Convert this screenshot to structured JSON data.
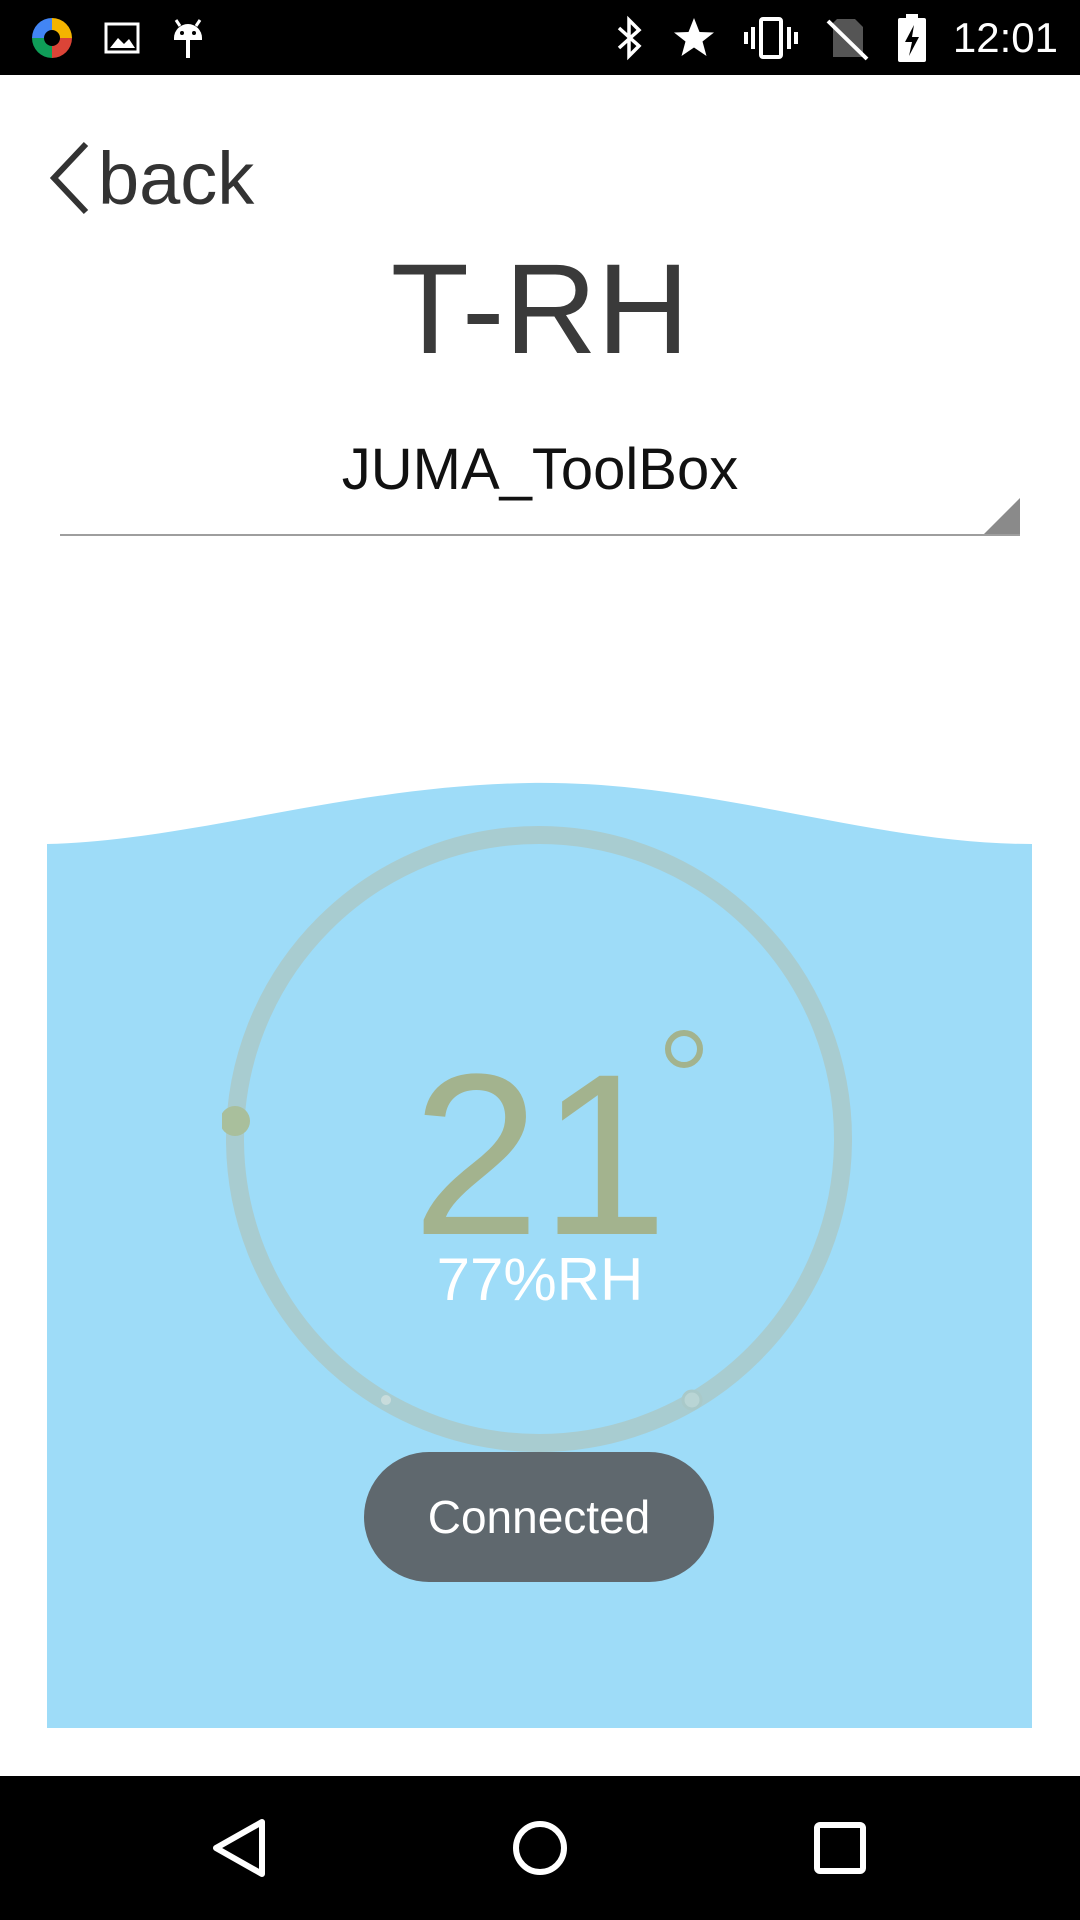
{
  "status_bar": {
    "time": "12:01",
    "left_icons": [
      "app-store-icon",
      "image-icon",
      "android-debug-icon"
    ],
    "right_icons": [
      "bluetooth-icon",
      "star-icon",
      "vibrate-icon",
      "no-sim-icon",
      "battery-charging-icon"
    ]
  },
  "header": {
    "back_label": "back",
    "title": "T-RH"
  },
  "device_select": {
    "selected": "JUMA_ToolBox"
  },
  "reading": {
    "temperature": "21",
    "humidity": "77%RH"
  },
  "toast": {
    "message": "Connected"
  },
  "colors": {
    "water": "#9edcf8",
    "gauge_ring": "#a9c9c9",
    "temperature_text": "#a3b38e",
    "toast_bg": "#5f686e"
  },
  "nav_bar": {
    "buttons": [
      "back-nav-icon",
      "home-nav-icon",
      "recents-nav-icon"
    ]
  }
}
